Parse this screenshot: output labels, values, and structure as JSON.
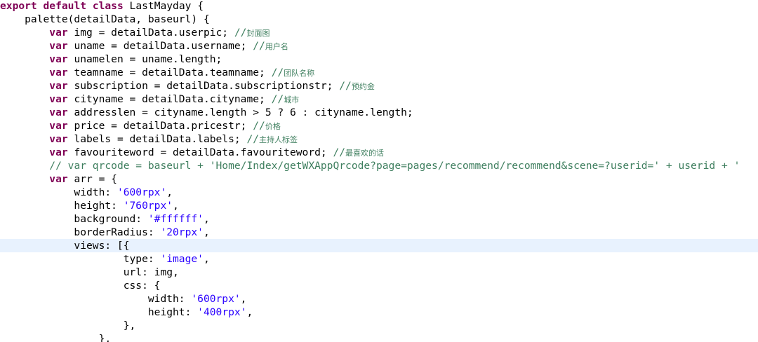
{
  "editor": {
    "current_line": 18,
    "colors": {
      "keyword": "#7f0055",
      "string": "#2a00ff",
      "comment": "#3f7f5f",
      "current_line_bg": "#e8f2fe"
    },
    "lines": [
      {
        "tokens": [
          {
            "t": "export",
            "c": "kw"
          },
          {
            "t": " "
          },
          {
            "t": "default",
            "c": "kw"
          },
          {
            "t": " "
          },
          {
            "t": "class",
            "c": "kw"
          },
          {
            "t": " LastMayday {"
          }
        ]
      },
      {
        "tokens": [
          {
            "t": "    palette(detailData, baseurl) {"
          }
        ]
      },
      {
        "tokens": [
          {
            "t": "        "
          },
          {
            "t": "var",
            "c": "kw"
          },
          {
            "t": " img = detailData.userpic; "
          },
          {
            "t": "//",
            "c": "cm"
          },
          {
            "t": "封面图",
            "c": "cm cjk"
          }
        ]
      },
      {
        "tokens": [
          {
            "t": "        "
          },
          {
            "t": "var",
            "c": "kw"
          },
          {
            "t": " uname = detailData.username; "
          },
          {
            "t": "//",
            "c": "cm"
          },
          {
            "t": "用户名",
            "c": "cm cjk"
          }
        ]
      },
      {
        "tokens": [
          {
            "t": "        "
          },
          {
            "t": "var",
            "c": "kw"
          },
          {
            "t": " unamelen = uname.length;"
          }
        ]
      },
      {
        "tokens": [
          {
            "t": "        "
          },
          {
            "t": "var",
            "c": "kw"
          },
          {
            "t": " teamname = detailData.teamname; "
          },
          {
            "t": "//",
            "c": "cm"
          },
          {
            "t": "团队名称",
            "c": "cm cjk"
          }
        ]
      },
      {
        "tokens": [
          {
            "t": "        "
          },
          {
            "t": "var",
            "c": "kw"
          },
          {
            "t": " subscription = detailData.subscriptionstr; "
          },
          {
            "t": "//",
            "c": "cm"
          },
          {
            "t": "预约金",
            "c": "cm cjk"
          }
        ]
      },
      {
        "tokens": [
          {
            "t": "        "
          },
          {
            "t": "var",
            "c": "kw"
          },
          {
            "t": " cityname = detailData.cityname; "
          },
          {
            "t": "//",
            "c": "cm"
          },
          {
            "t": "城市",
            "c": "cm cjk"
          }
        ]
      },
      {
        "tokens": [
          {
            "t": "        "
          },
          {
            "t": "var",
            "c": "kw"
          },
          {
            "t": " addresslen = cityname.length > 5 ? 6 : cityname.length;"
          }
        ]
      },
      {
        "tokens": [
          {
            "t": "        "
          },
          {
            "t": "var",
            "c": "kw"
          },
          {
            "t": " price = detailData.pricestr; "
          },
          {
            "t": "//",
            "c": "cm"
          },
          {
            "t": "价格",
            "c": "cm cjk"
          }
        ]
      },
      {
        "tokens": [
          {
            "t": "        "
          },
          {
            "t": "var",
            "c": "kw"
          },
          {
            "t": " labels = detailData.labels; "
          },
          {
            "t": "//",
            "c": "cm"
          },
          {
            "t": "主持人标签",
            "c": "cm cjk"
          }
        ]
      },
      {
        "tokens": [
          {
            "t": "        "
          },
          {
            "t": "var",
            "c": "kw"
          },
          {
            "t": " favouriteword = detailData.favouriteword; "
          },
          {
            "t": "//",
            "c": "cm"
          },
          {
            "t": "最喜欢的话",
            "c": "cm cjk"
          }
        ]
      },
      {
        "tokens": [
          {
            "t": "        "
          },
          {
            "t": "// var qrcode = baseurl + 'Home/Index/getWXAppQrcode?page=pages/recommend/recommend&scene=?userid=' + userid + '",
            "c": "cm"
          }
        ]
      },
      {
        "tokens": [
          {
            "t": "        "
          },
          {
            "t": "var",
            "c": "kw"
          },
          {
            "t": " arr = {"
          }
        ]
      },
      {
        "tokens": [
          {
            "t": "            width: "
          },
          {
            "t": "'600rpx'",
            "c": "str"
          },
          {
            "t": ","
          }
        ]
      },
      {
        "tokens": [
          {
            "t": "            height: "
          },
          {
            "t": "'760rpx'",
            "c": "str"
          },
          {
            "t": ","
          }
        ]
      },
      {
        "tokens": [
          {
            "t": "            background: "
          },
          {
            "t": "'#ffffff'",
            "c": "str"
          },
          {
            "t": ","
          }
        ]
      },
      {
        "tokens": [
          {
            "t": "            borderRadius: "
          },
          {
            "t": "'20rpx'",
            "c": "str"
          },
          {
            "t": ","
          }
        ]
      },
      {
        "tokens": [
          {
            "t": "            views: [{"
          }
        ]
      },
      {
        "tokens": [
          {
            "t": "                    type: "
          },
          {
            "t": "'image'",
            "c": "str"
          },
          {
            "t": ","
          }
        ]
      },
      {
        "tokens": [
          {
            "t": "                    url: img,"
          }
        ]
      },
      {
        "tokens": [
          {
            "t": "                    css: {"
          }
        ]
      },
      {
        "tokens": [
          {
            "t": "                        width: "
          },
          {
            "t": "'600rpx'",
            "c": "str"
          },
          {
            "t": ","
          }
        ]
      },
      {
        "tokens": [
          {
            "t": "                        height: "
          },
          {
            "t": "'400rpx'",
            "c": "str"
          },
          {
            "t": ","
          }
        ]
      },
      {
        "tokens": [
          {
            "t": "                    },"
          }
        ]
      },
      {
        "tokens": [
          {
            "t": "                },"
          }
        ]
      }
    ]
  }
}
